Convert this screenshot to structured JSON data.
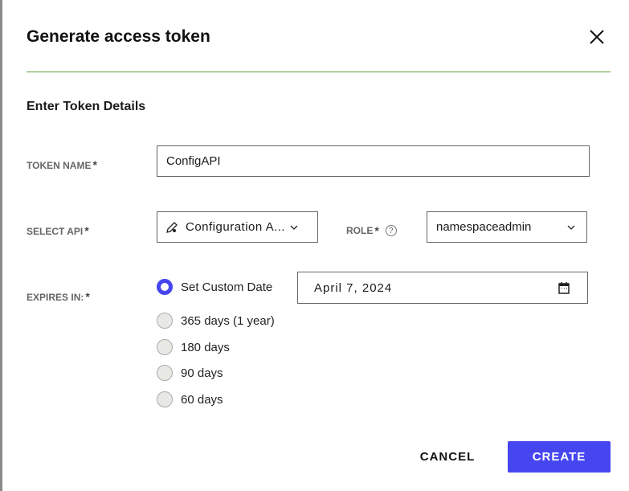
{
  "dialog": {
    "title": "Generate access token",
    "section": "Enter Token Details"
  },
  "token_name": {
    "label": "TOKEN NAME",
    "value": "ConfigAPI"
  },
  "api": {
    "label": "SELECT API",
    "value": "Configuration A..."
  },
  "role": {
    "label": "ROLE",
    "value": "namespaceadmin"
  },
  "expires": {
    "label": "EXPIRES IN:",
    "date": "April 7, 2024",
    "selected": 0,
    "options": [
      "Set Custom Date",
      "365 days (1 year)",
      "180 days",
      "90 days",
      "60 days"
    ]
  },
  "required_mark": "*",
  "help_mark": "?",
  "buttons": {
    "cancel": "CANCEL",
    "create": "CREATE"
  },
  "colors": {
    "accent": "#4646f0",
    "divider": "#5aa03c"
  }
}
